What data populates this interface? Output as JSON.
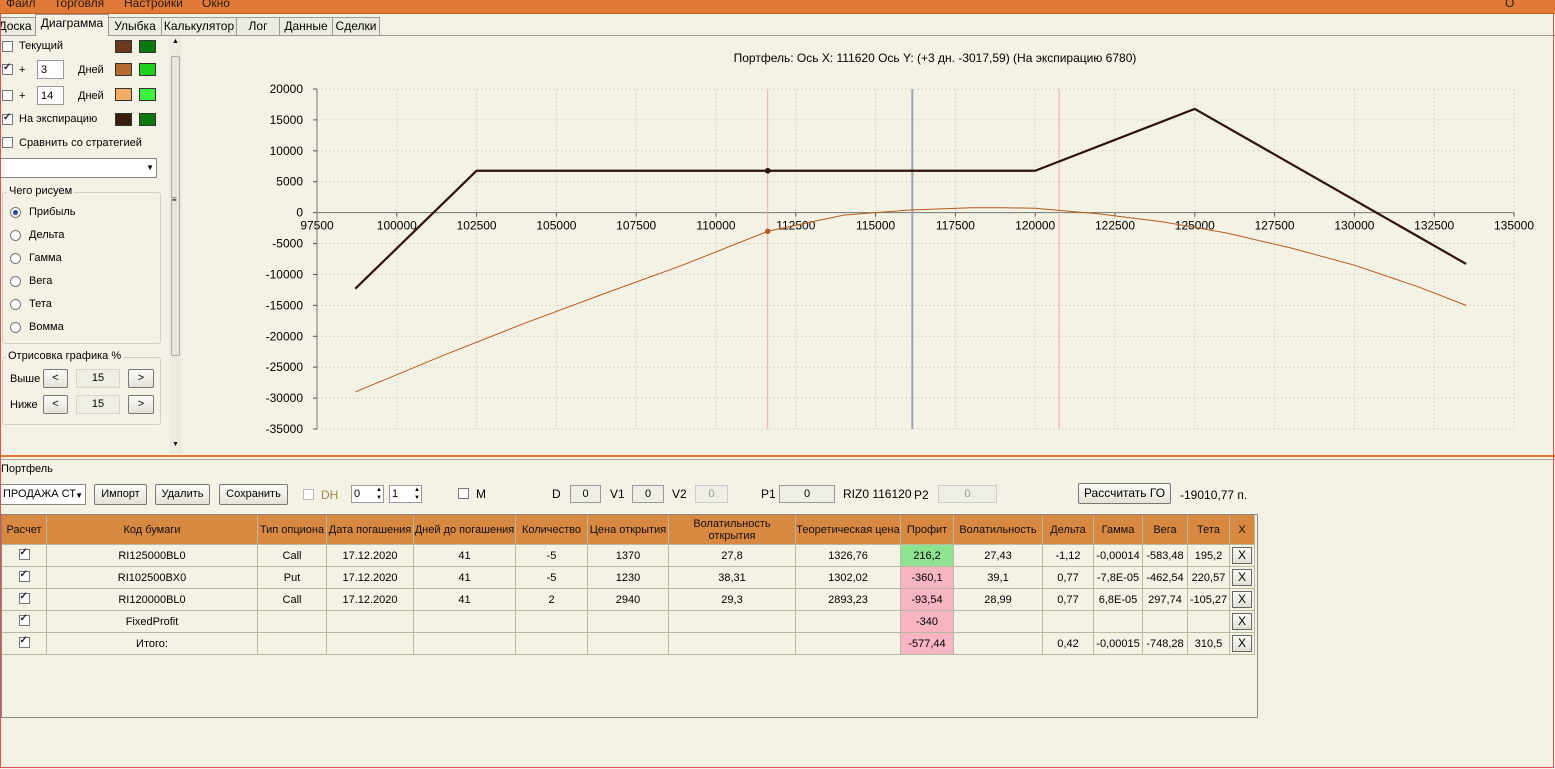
{
  "menu": [
    "Файл",
    "Торговля",
    "Настройки",
    "Окно"
  ],
  "menu_right": "О програ",
  "tabs": [
    {
      "label": "Доска",
      "active": false
    },
    {
      "label": "Диаграмма",
      "active": true
    },
    {
      "label": "Улыбка",
      "active": false
    },
    {
      "label": "Калькулятор",
      "active": false
    },
    {
      "label": "Лог",
      "active": false
    },
    {
      "label": "Данные",
      "active": false
    },
    {
      "label": "Сделки",
      "active": false
    }
  ],
  "left": {
    "current": {
      "label": "Текущий",
      "checked": false,
      "colors": [
        "#6b3a1e",
        "#0a7a10"
      ]
    },
    "plus1": {
      "plus": "+",
      "days_value": "3",
      "days_label": "Дней",
      "checked": true,
      "colors": [
        "#b56a2e",
        "#1fd01f"
      ]
    },
    "plus2": {
      "plus": "+",
      "days_value": "14",
      "days_label": "Дней",
      "checked": false,
      "colors": [
        "#f5ac62",
        "#3cf03c"
      ]
    },
    "expiry": {
      "label": "На экспирацию",
      "checked": true,
      "colors": [
        "#3a1e0c",
        "#0a7a10"
      ]
    },
    "compare": {
      "label": "Сравнить со стратегией",
      "checked": false
    },
    "strategy_combo": "",
    "draw_group": {
      "title": "Чего рисуем",
      "options": [
        "Прибыль",
        "Дельта",
        "Гамма",
        "Вега",
        "Тета",
        "Вомма"
      ],
      "selected": 0
    },
    "render_group": {
      "title": "Отрисовка графика %",
      "above_label": "Выше",
      "above_value": "15",
      "below_label": "Ниже",
      "below_value": "15",
      "dec": "<",
      "inc": ">"
    }
  },
  "chart_data": {
    "type": "line",
    "title": "Портфель: Ось X: 111620 Ось Y:  (+3 дн. -3017,59)  (На экспирацию 6780)",
    "xlim": [
      97500,
      135000
    ],
    "ylim": [
      -35000,
      20000
    ],
    "x_ticks": [
      97500,
      100000,
      102500,
      105000,
      107500,
      110000,
      112500,
      115000,
      117500,
      120000,
      122500,
      125000,
      127500,
      130000,
      132500,
      135000
    ],
    "y_ticks": [
      20000,
      15000,
      10000,
      5000,
      0,
      -5000,
      -10000,
      -15000,
      -20000,
      -25000,
      -30000,
      -35000
    ],
    "x_tick_labels": [
      "97500",
      "100000",
      "102500",
      "105000",
      "107500",
      "110000",
      "112500",
      "115000",
      "117500",
      "120000",
      "122500",
      "125000",
      "127500",
      "130000",
      "132500",
      "135000"
    ],
    "y_tick_labels": [
      "20000",
      "15000",
      "10000",
      "5000",
      "0",
      "-5000",
      "-10000",
      "-15000",
      "-20000",
      "-25000",
      "-30000",
      "-35000"
    ],
    "series": [
      {
        "color": "#2e1408",
        "width": 2.2,
        "x": [
          98700,
          102500,
          120000,
          125000,
          133500
        ],
        "y": [
          -12300,
          6780,
          6780,
          16780,
          -8300
        ]
      },
      {
        "color": "#b85a20",
        "width": 1,
        "x": [
          98700,
          101500,
          104000,
          106500,
          109000,
          111620,
          114000,
          116000,
          118000,
          119000,
          120000,
          122000,
          124000,
          126000,
          128000,
          130000,
          132000,
          133500
        ],
        "y": [
          -29000,
          -23000,
          -17900,
          -13100,
          -8400,
          -3018,
          -400,
          400,
          800,
          800,
          700,
          -200,
          -1500,
          -3300,
          -5700,
          -8500,
          -12000,
          -15000
        ]
      }
    ],
    "markers": [
      {
        "x": 111620,
        "y": 6780,
        "color": "#2e1408"
      },
      {
        "x": 111620,
        "y": -3018,
        "color": "#b85a20"
      }
    ],
    "vlines": [
      {
        "x": 111620,
        "color": "#f4aaaa"
      },
      {
        "x": 116150,
        "color": "#9aa4b0"
      },
      {
        "x": 120750,
        "color": "#f4aaaa"
      }
    ],
    "grid": true
  },
  "portfolio": {
    "label": "Портфель",
    "strategy": "ПРОДАЖА СТ",
    "import": "Импорт",
    "delete": "Удалить",
    "save": "Сохранить",
    "dh": "DH",
    "spin1": "0",
    "spin2": "1",
    "m": "M",
    "d_label": "D",
    "d_value": "0",
    "v1_label": "V1",
    "v1_value": "0",
    "v2_label": "V2",
    "v2_value": "0",
    "p1_label": "P1",
    "p1_value": "0",
    "riz_label": "RIZ0 116120",
    "p2_label": "P2",
    "p2_value": "0",
    "calc_go": "Рассчитать ГО",
    "go_value": "-19010,77 п."
  },
  "table": {
    "headers": [
      "Расчет",
      "Код бумаги",
      "Тип опциона",
      "Дата погашения",
      "Дней до погашения",
      "Количество",
      "Цена открытия",
      "Волатильность открытия",
      "Теоретическая цена",
      "Профит",
      "Волатильность",
      "Дельта",
      "Гамма",
      "Вега",
      "Тета",
      "X"
    ],
    "rows": [
      {
        "checked": true,
        "cells": [
          "RI125000BL0",
          "Call",
          "17.12.2020",
          "41",
          "-5",
          "1370",
          "27,8",
          "1326,76",
          "216,2",
          "27,43",
          "-1,12",
          "-0,00014",
          "-583,48",
          "195,2"
        ],
        "profit_color": "green",
        "x": "X"
      },
      {
        "checked": true,
        "cells": [
          "RI102500BX0",
          "Put",
          "17.12.2020",
          "41",
          "-5",
          "1230",
          "38,31",
          "1302,02",
          "-360,1",
          "39,1",
          "0,77",
          "-7,8E-05",
          "-462,54",
          "220,57"
        ],
        "profit_color": "pink",
        "x": "X"
      },
      {
        "checked": true,
        "cells": [
          "RI120000BL0",
          "Call",
          "17.12.2020",
          "41",
          "2",
          "2940",
          "29,3",
          "2893,23",
          "-93,54",
          "28,99",
          "0,77",
          "6,8E-05",
          "297,74",
          "-105,27"
        ],
        "profit_color": "pink",
        "x": "X"
      },
      {
        "checked": true,
        "cells": [
          "FixedProfit",
          "",
          "",
          "",
          "",
          "",
          "",
          "",
          "-340",
          "",
          "",
          "",
          "",
          ""
        ],
        "profit_color": "pink",
        "x": "X"
      },
      {
        "checked": true,
        "cells": [
          "Итого:",
          "",
          "",
          "",
          "",
          "",
          "",
          "",
          "-577,44",
          "",
          "0,42",
          "-0,00015",
          "-748,28",
          "310,5"
        ],
        "profit_color": "pink",
        "x": "X"
      }
    ]
  }
}
